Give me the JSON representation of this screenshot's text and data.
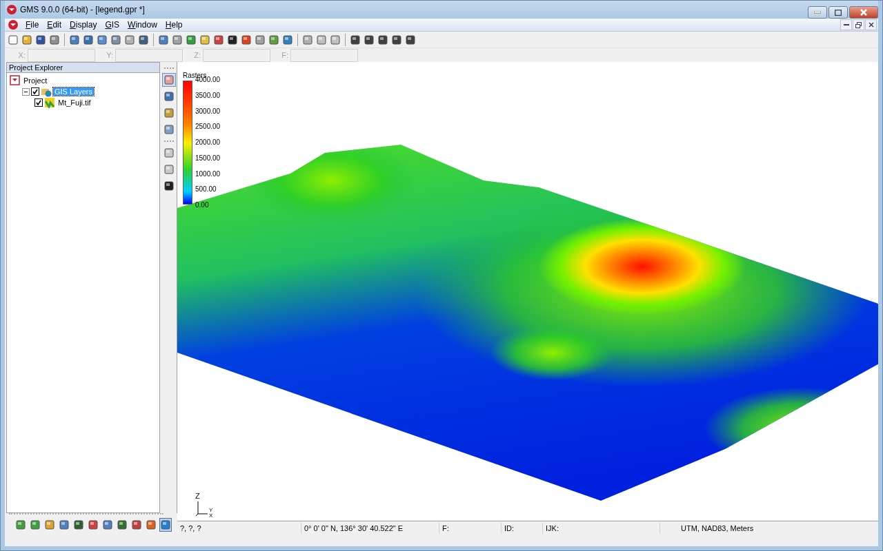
{
  "window": {
    "title": "GMS 9.0.0 (64-bit) - [legend.gpr *]"
  },
  "menu": [
    "File",
    "Edit",
    "Display",
    "GIS",
    "Window",
    "Help"
  ],
  "coordinates": [
    "X:",
    "Y:",
    "Z:",
    "F:"
  ],
  "project_explorer": {
    "title": "Project Explorer",
    "tree": [
      {
        "label": "Project",
        "kind": "project",
        "children": [
          {
            "label": "GIS Layers",
            "kind": "folder",
            "checked": true,
            "selected": true,
            "expanded": true,
            "children": [
              {
                "label": "Mt_Fuji.tif",
                "kind": "raster",
                "checked": true,
                "selected": false
              }
            ]
          }
        ]
      }
    ]
  },
  "view_tools": [
    {
      "selected": true
    },
    {
      "selected": false
    },
    {
      "selected": false
    },
    {
      "selected": false
    }
  ],
  "select_tools": [
    {
      "disabled": true
    },
    {
      "disabled": true
    },
    {
      "disabled": false
    }
  ],
  "legend": {
    "title": "Rasters",
    "labels": [
      "4000.00",
      "3500.00",
      "3000.00",
      "2500.00",
      "2000.00",
      "1500.00",
      "1000.00",
      "500.00",
      "0.00"
    ]
  },
  "axis_labels": [
    "Z",
    "Y",
    "X"
  ],
  "modules": [
    {
      "selected": false
    },
    {
      "selected": false
    },
    {
      "selected": false
    },
    {
      "selected": false
    },
    {
      "selected": false
    },
    {
      "selected": false
    },
    {
      "selected": false
    },
    {
      "selected": false
    },
    {
      "selected": false
    },
    {
      "selected": false
    },
    {
      "selected": true
    }
  ],
  "status_bar": [
    "?, ?, ?",
    "0° 0' 0\" N, 136° 30' 40.522\" E",
    "F:",
    "ID:",
    "IJK:",
    "UTM, NAD83, Meters"
  ]
}
